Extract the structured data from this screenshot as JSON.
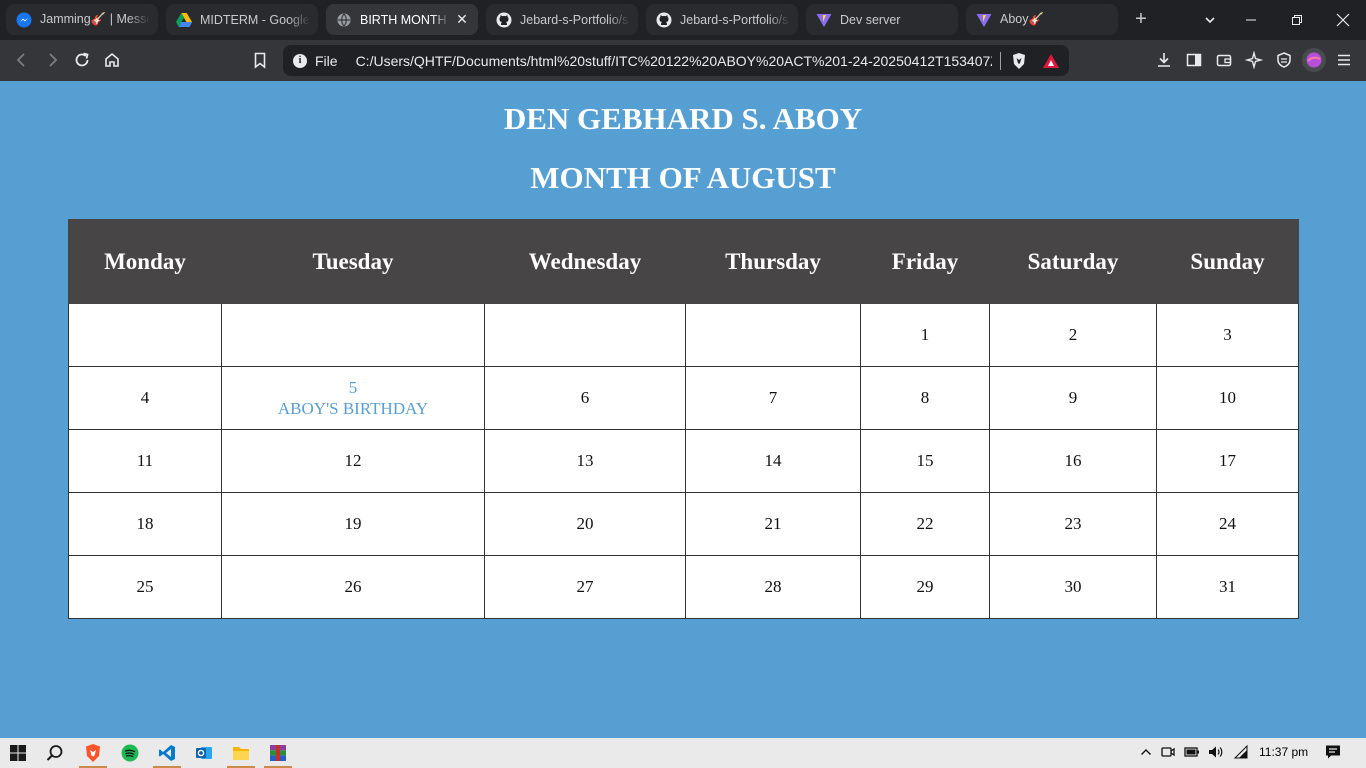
{
  "browser": {
    "tabs": [
      {
        "title": "Jamming🎸 | Messenger",
        "icon": "messenger-icon",
        "state": "inactive"
      },
      {
        "title": "MIDTERM - Google Drive",
        "icon": "google-drive-icon",
        "state": "inactive"
      },
      {
        "title": "BIRTH MONTH CALENDAR",
        "icon": "globe-icon",
        "state": "active"
      },
      {
        "title": "Jebard-s-Portfolio/st",
        "icon": "github-icon",
        "state": "inactive"
      },
      {
        "title": "Jebard-s-Portfolio/st",
        "icon": "github-icon",
        "state": "inactive"
      },
      {
        "title": "Dev server",
        "icon": "vite-icon",
        "state": "inactive"
      },
      {
        "title": "Aboy🎸",
        "icon": "vite-icon",
        "state": "inactive"
      }
    ],
    "address": {
      "scheme_label": "File",
      "url": "C:/Users/QHTF/Documents/html%20stuff/ITC%20122%20ABOY%20ACT%201-24-20250412T153407Z..."
    }
  },
  "page": {
    "name": "DEN GEBHARD S. ABOY",
    "month_title": "MONTH OF AUGUST",
    "weekdays": [
      "Monday",
      "Tuesday",
      "Wednesday",
      "Thursday",
      "Friday",
      "Saturday",
      "Sunday"
    ],
    "weeks": [
      [
        "",
        "",
        "",
        "",
        "1",
        "2",
        "3"
      ],
      [
        "4",
        "5",
        "6",
        "7",
        "8",
        "9",
        "10"
      ],
      [
        "11",
        "12",
        "13",
        "14",
        "15",
        "16",
        "17"
      ],
      [
        "18",
        "19",
        "20",
        "21",
        "22",
        "23",
        "24"
      ],
      [
        "25",
        "26",
        "27",
        "28",
        "29",
        "30",
        "31"
      ]
    ],
    "birthday_note": "ABOY'S BIRTHDAY",
    "colors": {
      "background": "#569fd3",
      "header": "#474545",
      "highlight": "#5a9ed1"
    }
  },
  "taskbar": {
    "apps": [
      "windows-start-icon",
      "search-icon",
      "brave-icon",
      "spotify-icon",
      "vscode-icon",
      "outlook-icon",
      "file-explorer-icon",
      "winrar-icon"
    ],
    "clock": "11:37 pm"
  }
}
